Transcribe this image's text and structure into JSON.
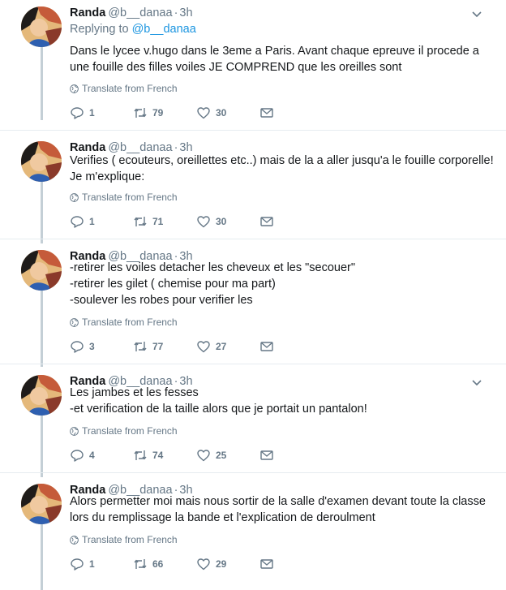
{
  "tweets": [
    {
      "name": "Randa",
      "handle": "@b__danaa",
      "time": "3h",
      "replying_prefix": "Replying to ",
      "replying_to": "@b__danaa",
      "lines": [
        "Dans le lycee v.hugo dans le 3eme a Paris. Avant chaque epreuve il procede a",
        "une fouille des filles voiles JE COMPREND que les oreilles sont"
      ],
      "translate": "Translate from French",
      "replies": "1",
      "retweets": "79",
      "likes": "30"
    },
    {
      "name": "Randa",
      "handle": "@b__danaa",
      "time": "3h",
      "lines": [
        "Verifies ( ecouteurs, oreillettes etc..) mais de la a aller jusqu'a le fouille corporelle!",
        "Je m'explique:"
      ],
      "translate": "Translate from French",
      "replies": "1",
      "retweets": "71",
      "likes": "30"
    },
    {
      "name": "Randa",
      "handle": "@b__danaa",
      "time": "3h",
      "lines": [
        "-retirer les voiles detacher les cheveux et les \"secouer\"",
        "-retirer les gilet ( chemise pour ma part)",
        "-soulever les robes pour verifier les"
      ],
      "translate": "Translate from French",
      "replies": "3",
      "retweets": "77",
      "likes": "27"
    },
    {
      "name": "Randa",
      "handle": "@b__danaa",
      "time": "3h",
      "lines": [
        "Les jambes et les fesses",
        "-et verification de la taille alors que je portait un pantalon!"
      ],
      "translate": "Translate from French",
      "replies": "4",
      "retweets": "74",
      "likes": "25"
    },
    {
      "name": "Randa",
      "handle": "@b__danaa",
      "time": "3h",
      "lines": [
        "Alors permetter moi mais nous sortir de la salle d'examen devant toute la classe",
        "lors du remplissage la bande et l'explication de deroulment"
      ],
      "translate": "Translate from French",
      "replies": "1",
      "retweets": "66",
      "likes": "29"
    }
  ],
  "colors": {
    "link": "#1b95e0",
    "muted": "#657786",
    "thread_line": "#c4cfd6"
  },
  "icons": [
    "chevron-down-icon",
    "globe-icon",
    "reply-icon",
    "retweet-icon",
    "like-icon",
    "direct-message-icon"
  ]
}
